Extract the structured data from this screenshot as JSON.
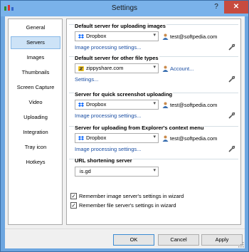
{
  "window": {
    "title": "Settings",
    "help_label": "?",
    "close_label": "✕"
  },
  "nav": {
    "items": [
      {
        "label": "General",
        "active": false
      },
      {
        "label": "Servers",
        "active": true
      },
      {
        "label": "Images",
        "active": false
      },
      {
        "label": "Thumbnails",
        "active": false
      },
      {
        "label": "Screen Capture",
        "active": false
      },
      {
        "label": "Video",
        "active": false
      },
      {
        "label": "Uploading",
        "active": false
      },
      {
        "label": "Integration",
        "active": false
      },
      {
        "label": "Tray icon",
        "active": false
      },
      {
        "label": "Hotkeys",
        "active": false
      }
    ]
  },
  "groups": {
    "image_server": {
      "title": "Default server for uploading images",
      "server": "Dropbox",
      "account": "test@softpedia.com",
      "settings_link": "Image processing settings..."
    },
    "file_server": {
      "title": "Default server for other file types",
      "server": "zippyshare.com",
      "account": "Account...",
      "settings_link": "Settings..."
    },
    "screenshot_server": {
      "title": "Server for quick screenshot uploading",
      "server": "Dropbox",
      "account": "test@softpedia.com",
      "settings_link": "Image processing settings..."
    },
    "context_menu_server": {
      "title": "Server for uploading from Explorer's context menu",
      "server": "Dropbox",
      "account": "test@softpedia.com",
      "settings_link": "Image processing settings..."
    },
    "url_shortening": {
      "title": "URL shortening server",
      "server": "is.gd"
    }
  },
  "checkboxes": {
    "remember_image": {
      "label": "Remember image server's settings in wizard",
      "checked": true
    },
    "remember_file": {
      "label": "Remember file server's settings in wizard",
      "checked": true
    }
  },
  "buttons": {
    "ok": "OK",
    "cancel": "Cancel",
    "apply": "Apply"
  },
  "glyphs": {
    "arrow": "▾",
    "check": "✓"
  },
  "colors": {
    "accent": "#1a4ea3",
    "selection": "#cde3f7",
    "titlebar": "#7ab2ea",
    "close": "#c74b3f"
  }
}
